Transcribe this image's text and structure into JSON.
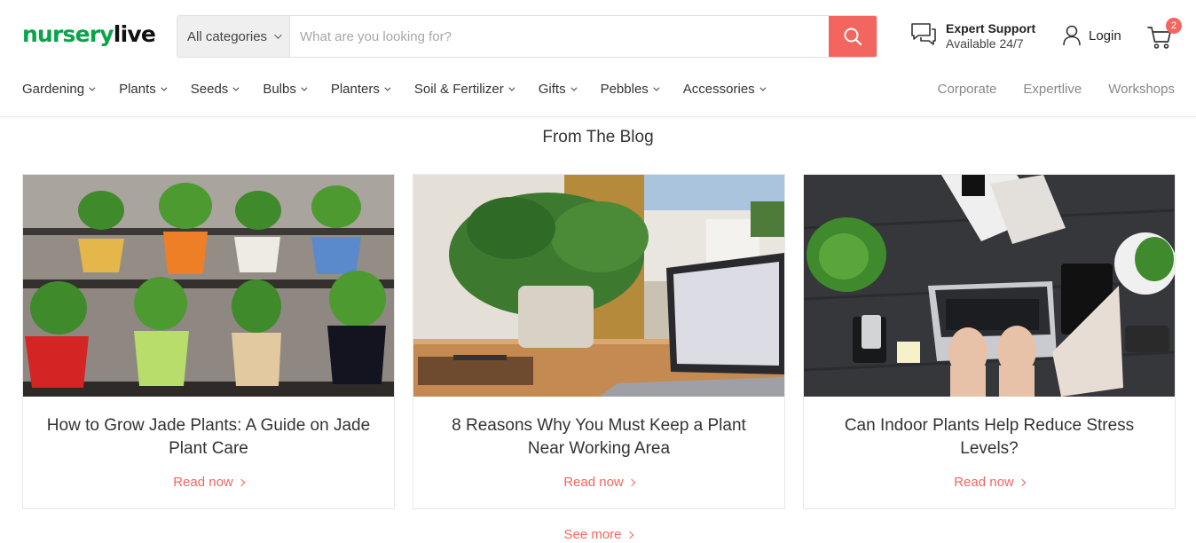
{
  "brand": {
    "part1": "nursery",
    "part2": "live"
  },
  "search": {
    "category": "All categories",
    "placeholder": "What are you looking for?"
  },
  "support": {
    "title": "Expert Support",
    "subtitle": "Available 24/7"
  },
  "account": {
    "login": "Login"
  },
  "cart": {
    "count": "2"
  },
  "nav": {
    "items": [
      "Gardening",
      "Plants",
      "Seeds",
      "Bulbs",
      "Planters",
      "Soil & Fertilizer",
      "Gifts",
      "Pebbles",
      "Accessories"
    ],
    "right": [
      "Corporate",
      "Expertlive",
      "Workshops"
    ]
  },
  "blog": {
    "heading": "From The Blog",
    "posts": [
      {
        "title": "How to Grow Jade Plants: A Guide on Jade Plant Care",
        "cta": "Read now"
      },
      {
        "title": "8 Reasons Why You Must Keep a Plant Near Working Area",
        "cta": "Read now"
      },
      {
        "title": "Can Indoor Plants Help Reduce Stress Levels?",
        "cta": "Read now"
      }
    ],
    "see_more": "See more"
  },
  "colors": {
    "brand_green": "#0aa34a",
    "accent": "#f3665f"
  }
}
